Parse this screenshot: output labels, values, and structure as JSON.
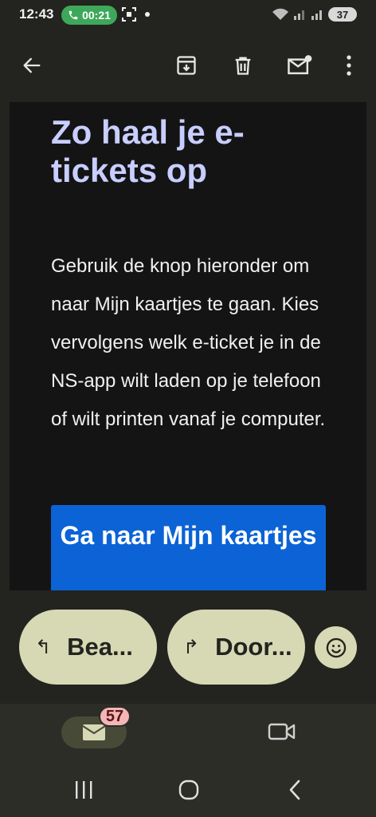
{
  "status_bar": {
    "time": "12:43",
    "call_timer": "00:21",
    "battery": "37"
  },
  "email": {
    "heading": "Zo haal je e-tickets op",
    "body": "Gebruik de knop hieronder om naar Mijn kaartjes te gaan. Kies vervolgens welk e-ticket je in de NS-app wilt laden op je telefoon of wilt printen vanaf je computer.",
    "cta_label": "Ga naar Mijn kaartjes"
  },
  "actions": {
    "reply_label": "Bea...",
    "forward_label": "Door..."
  },
  "bottom_nav": {
    "mail_badge": "57"
  },
  "colors": {
    "background": "#23241f",
    "heading": "#c8ceff",
    "cta": "#0b63d6",
    "pill": "#d7d9b5",
    "badge": "#f4b6b6"
  },
  "icons": {
    "back": "arrow-left-icon",
    "archive": "archive-icon",
    "delete": "trash-icon",
    "mark_unread": "mail-unread-icon",
    "more": "more-vertical-icon",
    "reply": "reply-icon",
    "forward": "forward-icon",
    "emoji": "emoji-icon",
    "mail": "mail-icon",
    "video": "video-icon"
  }
}
